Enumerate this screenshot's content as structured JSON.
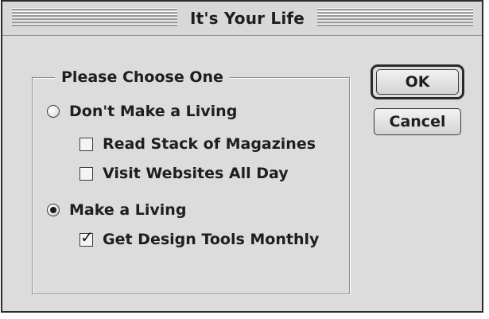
{
  "window": {
    "title": "It's Your Life"
  },
  "group": {
    "label": "Please Choose One",
    "options": [
      {
        "label": "Don't Make a Living",
        "selected": false,
        "suboptions": [
          {
            "label": "Read Stack of Magazines",
            "checked": false
          },
          {
            "label": "Visit Websites All Day",
            "checked": false
          }
        ]
      },
      {
        "label": "Make a Living",
        "selected": true,
        "suboptions": [
          {
            "label": "Get Design Tools Monthly",
            "checked": true
          }
        ]
      }
    ]
  },
  "buttons": {
    "ok_label": "OK",
    "cancel_label": "Cancel"
  }
}
